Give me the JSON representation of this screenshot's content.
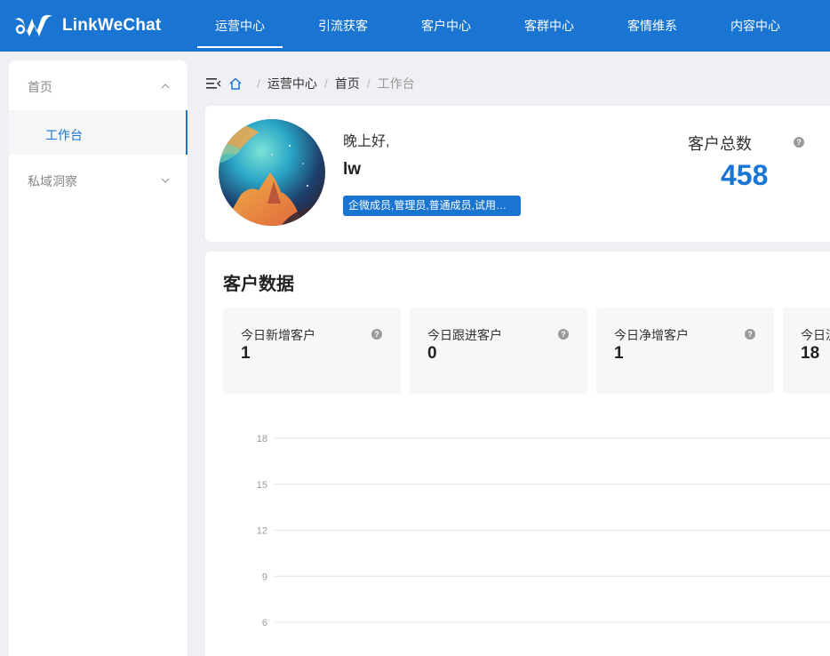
{
  "header": {
    "brand": "LinkWeChat",
    "nav": [
      {
        "label": "运营中心",
        "active": true
      },
      {
        "label": "引流获客",
        "active": false
      },
      {
        "label": "客户中心",
        "active": false
      },
      {
        "label": "客群中心",
        "active": false
      },
      {
        "label": "客情维系",
        "active": false
      },
      {
        "label": "内容中心",
        "active": false
      }
    ]
  },
  "sidebar": {
    "groups": [
      {
        "label": "首页",
        "expanded": true,
        "children": [
          {
            "label": "工作台",
            "active": true
          }
        ]
      },
      {
        "label": "私域洞察",
        "expanded": false,
        "children": []
      }
    ]
  },
  "breadcrumb": {
    "items": [
      "运营中心",
      "首页",
      "工作台"
    ]
  },
  "profile": {
    "greeting": "晚上好,",
    "username": "lw",
    "roles": "企微成员,管理员,普通成员,试用账号",
    "total_label": "客户总数",
    "total_value": "458"
  },
  "customer_data": {
    "title": "客户数据",
    "stats": [
      {
        "label": "今日新增客户",
        "value": "1"
      },
      {
        "label": "今日跟进客户",
        "value": "0"
      },
      {
        "label": "今日净增客户",
        "value": "1"
      },
      {
        "label": "今日流失客户",
        "value": "18"
      }
    ]
  },
  "colors": {
    "primary": "#1a75d2",
    "background": "#eef0f3",
    "card": "#ffffff",
    "stat_bg": "#f7f7f7"
  },
  "chart_data": {
    "type": "line",
    "title": "",
    "xlabel": "",
    "ylabel": "",
    "ylim": [
      0,
      18
    ],
    "yticks": [
      "18",
      "15",
      "12",
      "9",
      "6"
    ],
    "grid": true,
    "series": []
  }
}
